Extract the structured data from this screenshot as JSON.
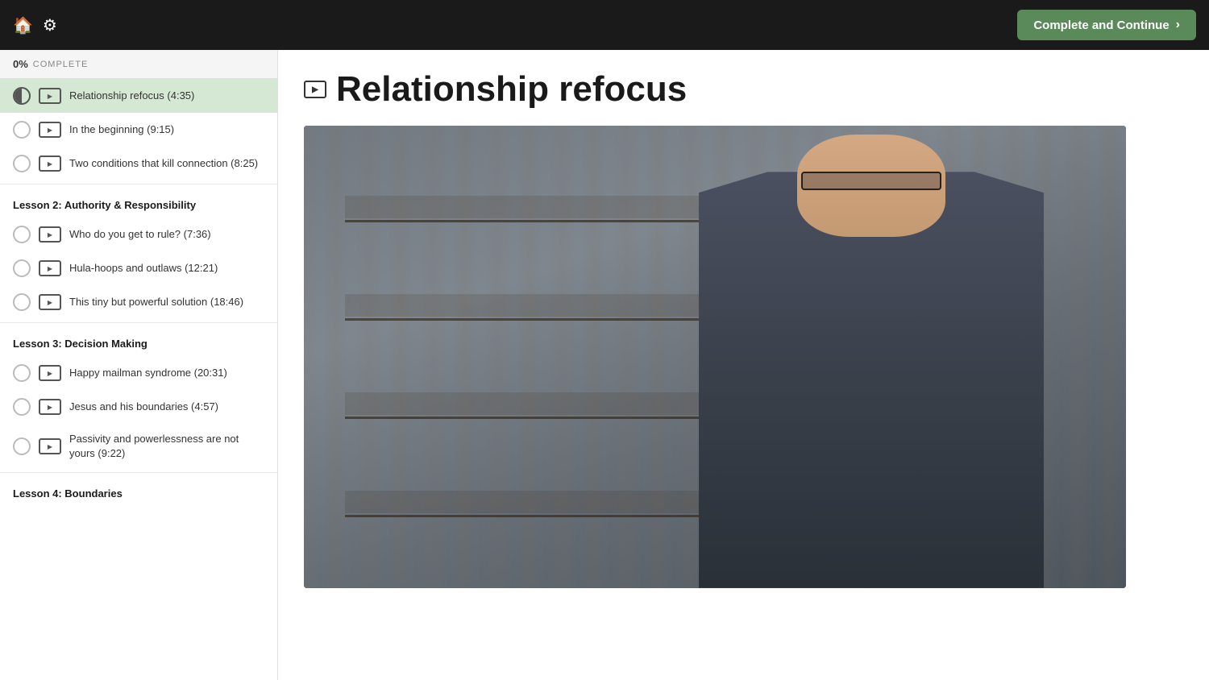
{
  "topNav": {
    "completeButton": "Complete and Continue",
    "homeIcon": "🏠",
    "settingsIcon": "⚙"
  },
  "sidebar": {
    "progress": {
      "percent": "0%",
      "label": "COMPLETE"
    },
    "lessons": [
      {
        "header": null,
        "items": [
          {
            "title": "Relationship refocus (4:35)",
            "active": true,
            "status": "half"
          }
        ]
      },
      {
        "header": null,
        "items": [
          {
            "title": "In the beginning (9:15)",
            "active": false,
            "status": "empty"
          },
          {
            "title": "Two conditions that kill connection (8:25)",
            "active": false,
            "status": "empty"
          }
        ]
      },
      {
        "header": "Lesson 2: Authority & Responsibility",
        "items": [
          {
            "title": "Who do you get to rule? (7:36)",
            "active": false,
            "status": "empty"
          },
          {
            "title": "Hula-hoops and outlaws (12:21)",
            "active": false,
            "status": "empty"
          },
          {
            "title": "This tiny but powerful solution (18:46)",
            "active": false,
            "status": "empty"
          }
        ]
      },
      {
        "header": "Lesson 3: Decision Making",
        "items": [
          {
            "title": "Happy mailman syndrome (20:31)",
            "active": false,
            "status": "empty"
          },
          {
            "title": "Jesus and his boundaries (4:57)",
            "active": false,
            "status": "empty"
          },
          {
            "title": "Passivity and powerlessness are not yours (9:22)",
            "active": false,
            "status": "empty"
          }
        ]
      },
      {
        "header": "Lesson 4: Boundaries",
        "items": []
      }
    ]
  },
  "content": {
    "title": "Relationship refocus",
    "videoAlt": "Course video: Relationship refocus"
  }
}
